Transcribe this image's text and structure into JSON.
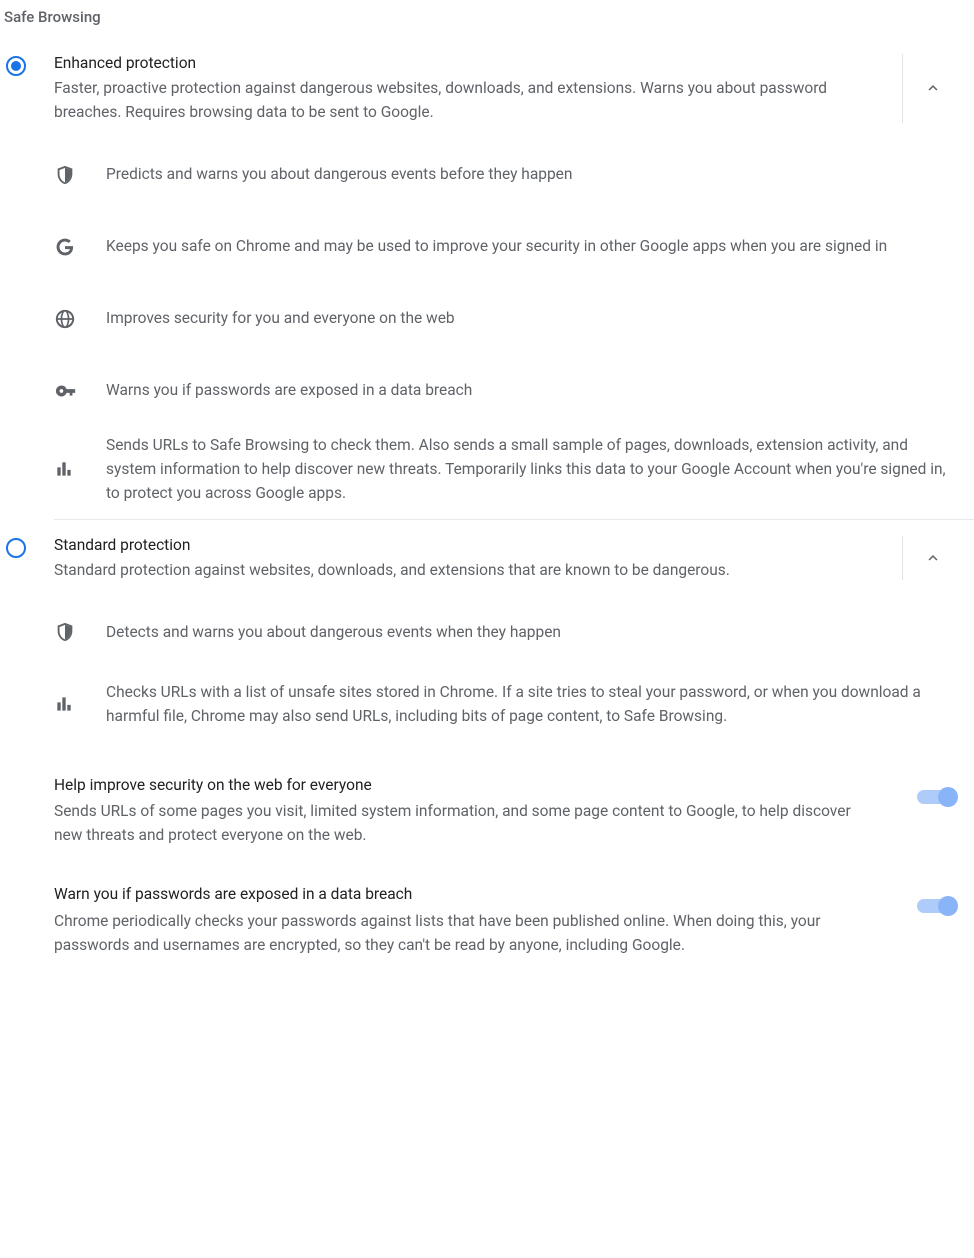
{
  "pageTitle": "Safe Browsing",
  "enhanced": {
    "title": "Enhanced protection",
    "desc": "Faster, proactive protection against dangerous websites, downloads, and extensions. Warns you about password breaches. Requires browsing data to be sent to Google.",
    "selected": true,
    "bullets": [
      "Predicts and warns you about dangerous events before they happen",
      "Keeps you safe on Chrome and may be used to improve your security in other Google apps when you are signed in",
      "Improves security for you and everyone on the web",
      "Warns you if passwords are exposed in a data breach",
      "Sends URLs to Safe Browsing to check them. Also sends a small sample of pages, downloads, extension activity, and system information to help discover new threats. Temporarily links this data to your Google Account when you're signed in, to protect you across Google apps."
    ]
  },
  "standard": {
    "title": "Standard protection",
    "desc": "Standard protection against websites, downloads, and extensions that are known to be dangerous.",
    "selected": false,
    "bullets": [
      "Detects and warns you about dangerous events when they happen",
      "Checks URLs with a list of unsafe sites stored in Chrome. If a site tries to steal your password, or when you download a harmful file, Chrome may also send URLs, including bits of page content, to Safe Browsing."
    ],
    "sub": [
      {
        "title": "Help improve security on the web for everyone",
        "desc": "Sends URLs of some pages you visit, limited system information, and some page content to Google, to help discover new threats and protect everyone on the web.",
        "on": true
      },
      {
        "title": "Warn you if passwords are exposed in a data breach",
        "desc": "Chrome periodically checks your passwords against lists that have been published online. When doing this, your passwords and usernames are encrypted, so they can't be read by anyone, including Google.",
        "on": true
      }
    ]
  }
}
